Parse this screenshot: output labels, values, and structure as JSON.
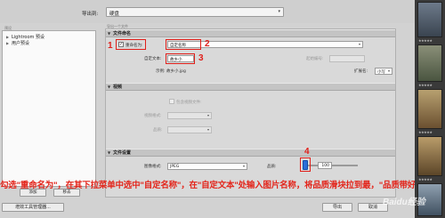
{
  "export_to": {
    "label": "导出到:",
    "value": "硬盘"
  },
  "left_panel": {
    "header": "预设",
    "tree": [
      {
        "label": "Lightroom 预设",
        "expanded": false
      },
      {
        "label": "用户预设",
        "expanded": false
      }
    ],
    "add_button": "添加",
    "remove_button": "移去",
    "plugin_manager_button": "增效工具管理器..."
  },
  "main": {
    "selected_preset_label": "导出一个文件",
    "file_naming": {
      "section_title": "文件命名",
      "rename_checkbox_label": "重命名为:",
      "rename_checked": true,
      "rename_select": "自定名称",
      "custom_text_label": "自定文本:",
      "custom_text_value": "故乡小",
      "start_number_label": "起始编号:",
      "example_label": "示例: 故乡小.jpg",
      "extension_label": "扩展名:",
      "extension_value": "小写"
    },
    "video": {
      "section_title": "视频",
      "include_video_label": "包含视频文件:",
      "video_format_label": "视频格式:",
      "quality_label": "品质:"
    },
    "file_settings": {
      "section_title": "文件设置",
      "image_format_label": "图像格式:",
      "image_format_value": "JPEG",
      "quality_label": "品质:",
      "quality_value": "100",
      "quality_fraction": 0.08
    }
  },
  "annotations": {
    "numbers": [
      "1",
      "2",
      "3",
      "4"
    ],
    "caption": "勾选\"重命名为\"，在其下拉菜单中选中\"自定名称\"，在\"自定文本\"处输入图片名称，将品质滑块拉到最，\"品质带好",
    "color": "#e0201b"
  },
  "bottom": {
    "export_button": "导出",
    "cancel_button": "取消"
  },
  "watermark": "Baidu经验",
  "icons": {
    "dropdown": "chevron-down-icon",
    "tree_expand": "triangle-right-icon",
    "section_collapse": "triangle-down-icon"
  }
}
